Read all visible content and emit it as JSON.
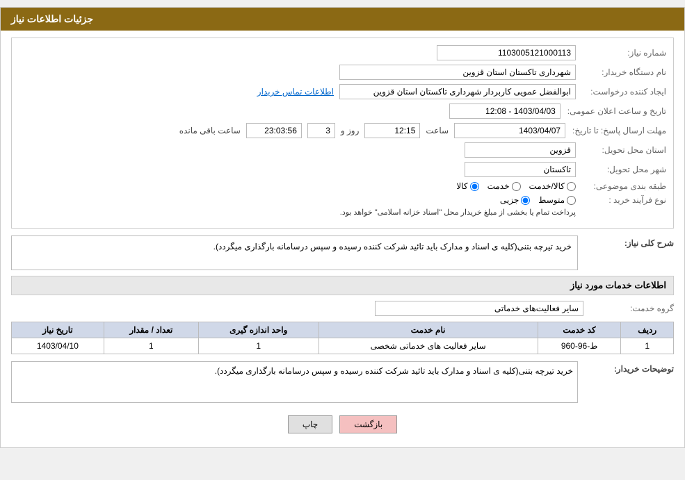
{
  "header": {
    "title": "جزئیات اطلاعات نیاز"
  },
  "fields": {
    "shenumber_label": "شماره نیاز:",
    "shenumber_value": "1103005121000113",
    "buyer_label": "نام دستگاه خریدار:",
    "buyer_value": "شهرداری تاکستان استان قزوین",
    "creator_label": "ایجاد کننده درخواست:",
    "creator_value": "ابوالفضل عمویی کاربردار شهرداری تاکستان استان قزوین",
    "contact_link": "اطلاعات تماس خریدار",
    "announcement_label": "تاریخ و ساعت اعلان عمومی:",
    "announcement_value": "1403/04/03 - 12:08",
    "deadline_label": "مهلت ارسال پاسخ: تا تاریخ:",
    "deadline_date": "1403/04/07",
    "deadline_time_label": "ساعت",
    "deadline_time": "12:15",
    "deadline_day_label": "روز و",
    "deadline_days": "3",
    "deadline_remaining": "23:03:56",
    "deadline_remaining_label": "ساعت باقی مانده",
    "province_label": "استان محل تحویل:",
    "province_value": "قزوین",
    "city_label": "شهر محل تحویل:",
    "city_value": "تاکستان",
    "category_label": "طبقه بندی موضوعی:",
    "category_kala": "کالا",
    "category_khedmat": "خدمت",
    "category_kala_khedmat": "کالا/خدمت",
    "process_label": "نوع فرآیند خرید :",
    "process_jozi": "جزیی",
    "process_motavaset": "متوسط",
    "process_desc": "پرداخت تمام یا بخشی از مبلغ خریدار محل \"اسناد خزانه اسلامی\" خواهد بود.",
    "sherh_label": "شرح کلی نیاز:",
    "sherh_value": "خرید تیرچه بتنی(کلیه ی اسناد و مدارک باید تائید شرکت کننده رسیده و سپس درسامانه بارگذاری میگردد).",
    "services_title": "اطلاعات خدمات مورد نیاز",
    "group_label": "گروه خدمت:",
    "group_value": "سایر فعالیت‌های خدماتی",
    "table": {
      "headers": [
        "ردیف",
        "کد خدمت",
        "نام خدمت",
        "واحد اندازه گیری",
        "تعداد / مقدار",
        "تاریخ نیاز"
      ],
      "rows": [
        {
          "row": "1",
          "code": "ط-96-960",
          "name": "سایر فعالیت های خدماتی شخصی",
          "unit": "1",
          "quantity": "1",
          "date": "1403/04/10"
        }
      ]
    },
    "buyer_desc_label": "توضیحات خریدار:",
    "buyer_desc_value": "خرید تیرچه بتنی(کلیه ی اسناد و مدارک باید تائید شرکت کننده رسیده و سپس درسامانه بارگذاری میگردد)."
  },
  "buttons": {
    "print": "چاپ",
    "back": "بازگشت"
  }
}
